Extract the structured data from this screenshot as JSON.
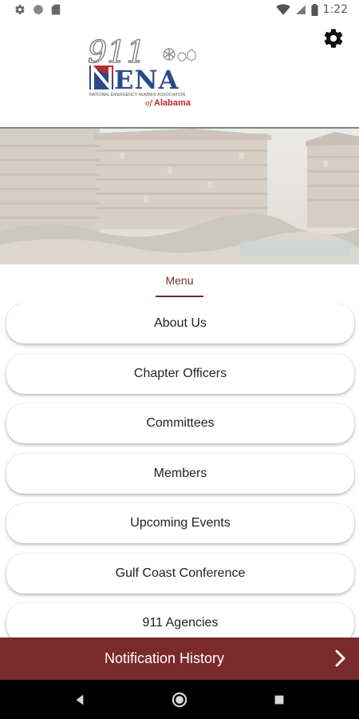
{
  "status_bar": {
    "time": "1:22",
    "left_icons": [
      "gear-icon",
      "circle-icon",
      "sd-card-icon"
    ],
    "right_icons": [
      "wifi-icon",
      "signal-icon",
      "battery-icon"
    ]
  },
  "header": {
    "logo": {
      "number": "911",
      "name": "NENA",
      "tagline": "NATIONAL EMERGENCY NUMBER ASSOCIATION",
      "of_text": "of",
      "state": "Alabama"
    },
    "settings_icon": "gear-icon"
  },
  "menu": {
    "heading": "Menu",
    "items": [
      {
        "label": "About Us"
      },
      {
        "label": "Chapter Officers"
      },
      {
        "label": "Committees"
      },
      {
        "label": "Members"
      },
      {
        "label": "Upcoming Events"
      },
      {
        "label": "Gulf Coast Conference"
      },
      {
        "label": "911 Agencies"
      }
    ]
  },
  "notification_bar": {
    "label": "Notification History",
    "icon": "chevron-right-icon"
  },
  "nav_bar": {
    "icons": [
      "back-icon",
      "home-icon",
      "recents-icon"
    ]
  },
  "colors": {
    "brand": "#7b2a2a",
    "divider": "#6f8f7a",
    "logo_blue": "#2c4a8a",
    "logo_red": "#c0262d"
  }
}
